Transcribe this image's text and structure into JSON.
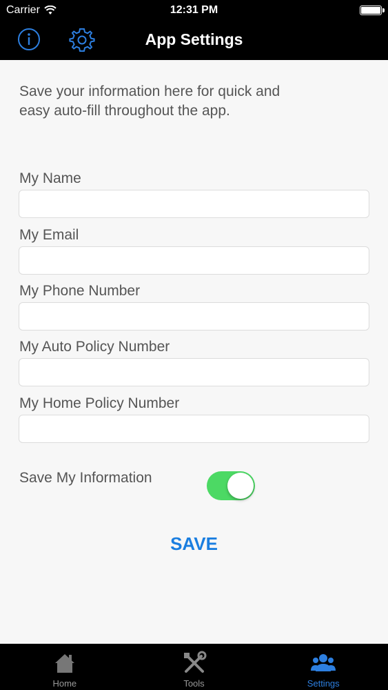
{
  "status_bar": {
    "carrier": "Carrier",
    "time": "12:31 PM"
  },
  "nav": {
    "title": "App Settings"
  },
  "intro_text": "Save your information here for quick and easy auto-fill throughout the app.",
  "fields": [
    {
      "label": "My Name",
      "value": "",
      "placeholder": ""
    },
    {
      "label": "My Email",
      "value": "",
      "placeholder": ""
    },
    {
      "label": "My Phone Number",
      "value": "",
      "placeholder": ""
    },
    {
      "label": "My Auto Policy Number",
      "value": "",
      "placeholder": ""
    },
    {
      "label": "My Home Policy Number",
      "value": "",
      "placeholder": ""
    }
  ],
  "toggle": {
    "label": "Save My Information",
    "on": true,
    "color": "#4cd964"
  },
  "save_button": {
    "label": "SAVE",
    "color": "#1a7ee0"
  },
  "tabs": [
    {
      "label": "Home",
      "icon": "home-icon",
      "active": false
    },
    {
      "label": "Tools",
      "icon": "tools-icon",
      "active": false
    },
    {
      "label": "Settings",
      "icon": "people-icon",
      "active": true
    }
  ],
  "colors": {
    "accent": "#2d7fe0",
    "bar_background": "#000000"
  }
}
